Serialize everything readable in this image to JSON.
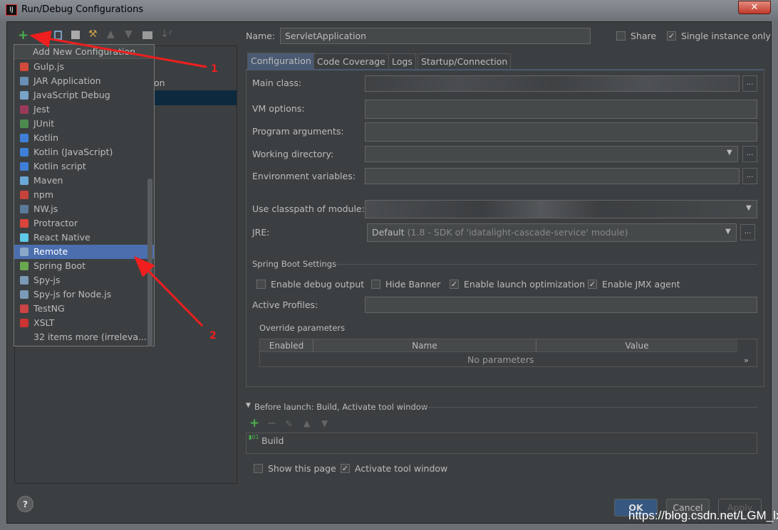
{
  "window": {
    "title": "Run/Debug Configurations",
    "close": "✕"
  },
  "toolbar": {
    "add": "+",
    "remove": "−"
  },
  "tree": {
    "partial_item": "ation"
  },
  "popup": {
    "header": "Add New Configuration",
    "items": [
      {
        "label": "Gulp.js",
        "color": "#d34a3a"
      },
      {
        "label": "JAR Application",
        "color": "#6a8fb5"
      },
      {
        "label": "JavaScript Debug",
        "color": "#7aa3c8"
      },
      {
        "label": "Jest",
        "color": "#9b3a5a"
      },
      {
        "label": "JUnit",
        "color": "#4d8a4d"
      },
      {
        "label": "Kotlin",
        "color": "#3f7fd8"
      },
      {
        "label": "Kotlin (JavaScript)",
        "color": "#3f7fd8"
      },
      {
        "label": "Kotlin script",
        "color": "#3f7fd8"
      },
      {
        "label": "Maven",
        "color": "#6aa8d8"
      },
      {
        "label": "npm",
        "color": "#c7423b"
      },
      {
        "label": "NW.js",
        "color": "#5b7a9a"
      },
      {
        "label": "Protractor",
        "color": "#d9453a"
      },
      {
        "label": "React Native",
        "color": "#5fc7e8"
      },
      {
        "label": "Remote",
        "color": "#8aa8c8"
      },
      {
        "label": "Spring Boot",
        "color": "#6aa84f"
      },
      {
        "label": "Spy-js",
        "color": "#7a9ab8"
      },
      {
        "label": "Spy-js for Node.js",
        "color": "#7a9ab8"
      },
      {
        "label": "TestNG",
        "color": "#c44"
      },
      {
        "label": "XSLT",
        "color": "#c33"
      },
      {
        "label": "32 items more (irreleva...",
        "color": ""
      }
    ],
    "selected": "Remote"
  },
  "name": {
    "label": "Name:",
    "value": "ServletApplication"
  },
  "share": {
    "label": "Share",
    "checked": false
  },
  "single_instance": {
    "label": "Single instance only",
    "checked": true
  },
  "tabs": [
    "Configuration",
    "Code Coverage",
    "Logs",
    "Startup/Connection"
  ],
  "form": {
    "main_class": "Main class:",
    "vm_options": "VM options:",
    "program_arguments": "Program arguments:",
    "working_directory": "Working directory:",
    "environment_variables": "Environment variables:",
    "classpath_module": "Use classpath of module:",
    "jre": "JRE:",
    "jre_value": "Default",
    "jre_detail": "(1.8 - SDK of 'idatalight-cascade-service' module)",
    "ellipsis": "..."
  },
  "spring_boot": {
    "title": "Spring Boot Settings",
    "options": [
      {
        "label": "Enable debug output",
        "checked": false
      },
      {
        "label": "Hide Banner",
        "checked": false
      },
      {
        "label": "Enable launch optimization",
        "checked": true
      },
      {
        "label": "Enable JMX agent",
        "checked": true
      }
    ],
    "active_profiles": "Active Profiles:"
  },
  "override": {
    "title": "Override parameters",
    "columns": [
      "Enabled",
      "Name",
      "Value"
    ],
    "empty": "No parameters",
    "more": "»"
  },
  "before_launch": {
    "title": "Before launch: Build, Activate tool window",
    "items": [
      "Build"
    ]
  },
  "show_page": {
    "label": "Show this page",
    "checked": false
  },
  "activate_tool": {
    "label": "Activate tool window",
    "checked": true
  },
  "buttons": {
    "ok": "OK",
    "cancel": "Cancel",
    "apply": "Apply",
    "help": "?"
  },
  "annotations": {
    "one": "1",
    "two": "2"
  },
  "watermark": "https://blog.csdn.net/LGM_lx"
}
